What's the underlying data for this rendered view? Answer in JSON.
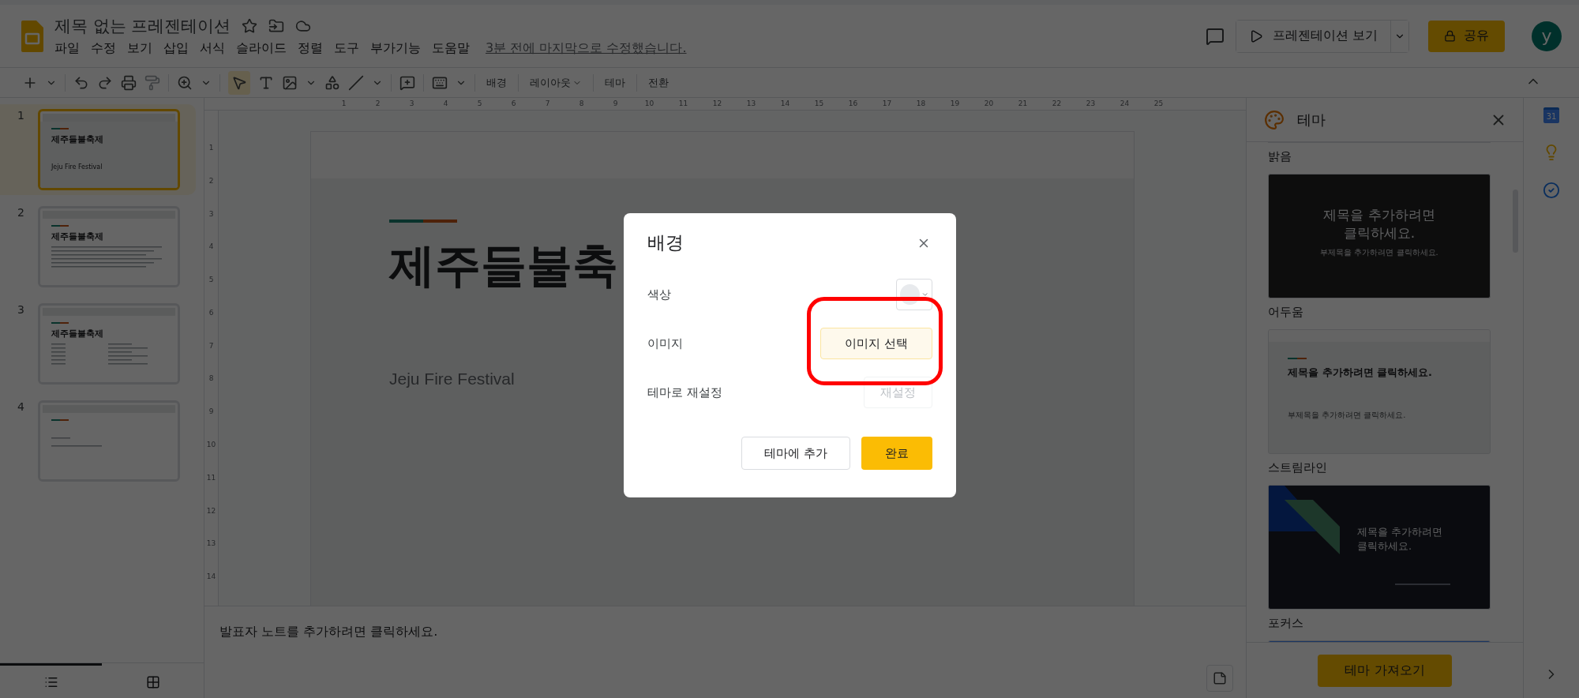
{
  "header": {
    "title": "제목 없는 프레젠테이션",
    "menus": [
      "파일",
      "수정",
      "보기",
      "삽입",
      "서식",
      "슬라이드",
      "정렬",
      "도구",
      "부가기능",
      "도움말"
    ],
    "last_edit": "3분 전에 마지막으로 수정했습니다.",
    "present_button": "프레젠테이션 보기",
    "share_button": "공유",
    "avatar": "y"
  },
  "toolbar": {
    "text_buttons": [
      {
        "label": "배경",
        "kind": "plain"
      },
      {
        "label": "레이아웃",
        "kind": "menu"
      },
      {
        "label": "테마",
        "kind": "plain"
      },
      {
        "label": "전환",
        "kind": "plain"
      }
    ]
  },
  "filmstrip": {
    "slides": [
      {
        "number": "1",
        "selected": true,
        "kind": "title",
        "title": "제주들불축제",
        "subtitle": "Jeju Fire Festival"
      },
      {
        "number": "2",
        "selected": false,
        "kind": "text",
        "title": "제주들불축제"
      },
      {
        "number": "3",
        "selected": false,
        "kind": "columns",
        "title": "제주들불축제"
      },
      {
        "number": "4",
        "selected": false,
        "kind": "blank"
      }
    ]
  },
  "ruler": {
    "horizontal": [
      "1",
      "2",
      "3",
      "4",
      "5",
      "6",
      "7",
      "8",
      "9",
      "10",
      "11",
      "12",
      "13",
      "14",
      "15",
      "16",
      "17",
      "18",
      "19",
      "20",
      "21",
      "22",
      "23",
      "24",
      "25"
    ],
    "vertical": [
      "1",
      "2",
      "3",
      "4",
      "5",
      "6",
      "7",
      "8",
      "9",
      "10",
      "11",
      "12",
      "13",
      "14"
    ]
  },
  "slide": {
    "title": "제주들불축",
    "subtitle": "Jeju Fire Festival"
  },
  "notes": {
    "placeholder": "발표자 노트를 추가하려면 클릭하세요."
  },
  "dialog": {
    "title": "배경",
    "rows": [
      {
        "label": "색상",
        "kind": "color"
      },
      {
        "label": "이미지",
        "kind": "button",
        "button": "이미지 선택",
        "disabled": false
      },
      {
        "label": "테마로 재설정",
        "kind": "button",
        "button": "재설정",
        "disabled": true
      }
    ],
    "buttons": [
      {
        "label": "테마에 추가",
        "kind": "secondary"
      },
      {
        "label": "완료",
        "kind": "primary"
      }
    ]
  },
  "theme_panel": {
    "title": "테마",
    "themes": [
      {
        "name": "밝음",
        "kind": "partial"
      },
      {
        "name": "어두움",
        "kind": "dark",
        "preview_title": "제목을 추가하려면\n클릭하세요.",
        "preview_subtitle": "부제목을 추가하려면 클릭하세요."
      },
      {
        "name": "스트림라인",
        "kind": "streamline",
        "preview_title": "제목을 추가하려면 클릭하세요.",
        "preview_subtitle": "부제목을 추가하려면 클릭하세요."
      },
      {
        "name": "포커스",
        "kind": "focus",
        "preview_title": "제목을 추가하려면\n클릭하세요."
      }
    ],
    "import_button": "테마 가져오기"
  },
  "side_rail": {
    "calendar_day": "31"
  }
}
